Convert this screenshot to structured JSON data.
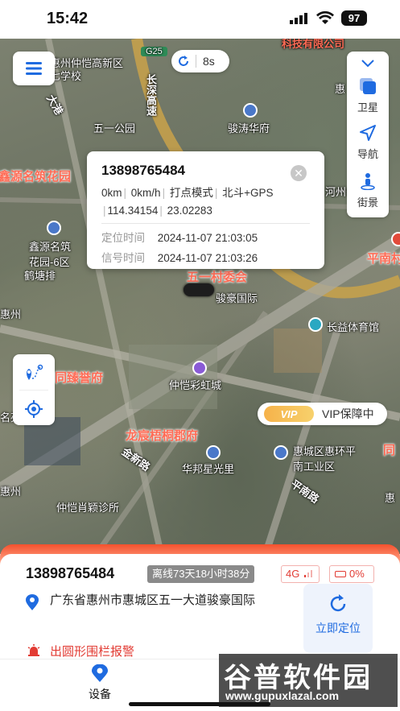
{
  "status_bar": {
    "time": "15:42",
    "battery": "97"
  },
  "map": {
    "refresh_interval": "8s",
    "layers": [
      {
        "label": "卫星",
        "icon": "satellite-icon"
      },
      {
        "label": "导航",
        "icon": "navigation-icon"
      },
      {
        "label": "街景",
        "icon": "street-view-icon"
      }
    ],
    "labels": {
      "l1": "惠州仲恺高新区",
      "l2": "七学校",
      "l3": "长深高速",
      "l4": "五一公园",
      "l5": "骏涛华府",
      "l6": "鑫源名筑花园",
      "l7": "鑫源名筑花园-6区",
      "l8": "鹤塘排",
      "l9": "五一村委会",
      "l10": "骏豪国际",
      "l11": "长益体育馆",
      "l12": "仲恺彩虹城",
      "l13": "龙宸梧桐郡府",
      "l14": "华邦星光里",
      "l15": "惠城区惠环平南工业区",
      "l16": "仲恺肖颖诊所",
      "l17": "平南村",
      "l18": "科技有限公司",
      "l19": "同臻誉府",
      "l20": "G25",
      "l21": "惠",
      "l22": "惠州",
      "l23": "同",
      "l24": "惠",
      "l25": "名苑",
      "l26": "惠州",
      "l27": "河州公",
      "l28": "大港",
      "l29": "平南路",
      "l30": "金新路"
    }
  },
  "popup": {
    "phone": "13898765484",
    "speed_line": [
      "0km",
      "0km/h",
      "打点模式",
      "北斗+GPS"
    ],
    "coords": [
      "114.34154",
      "23.02283"
    ],
    "locate_time_label": "定位时间",
    "locate_time": "2024-11-07 21:03:05",
    "signal_time_label": "信号时间",
    "signal_time": "2024-11-07 21:03:26"
  },
  "vip": {
    "tag": "VIP",
    "text": "VIP保障中"
  },
  "device": {
    "phone": "13898765484",
    "offline": "离线73天18小时38分",
    "network": "4G",
    "battery": "0%",
    "address": "广东省惠州市惠城区五一大道骏豪国际",
    "locate_button": "立即定位",
    "alarm": "出圆形围栏报警"
  },
  "tabbar": {
    "device": "设备"
  },
  "watermark": {
    "title": "谷普软件园",
    "url": "www.gupuxlazal.com"
  },
  "colors": {
    "accent": "#1f6be0",
    "alarm": "#e23b33",
    "sheet_top": "#f4512d"
  }
}
